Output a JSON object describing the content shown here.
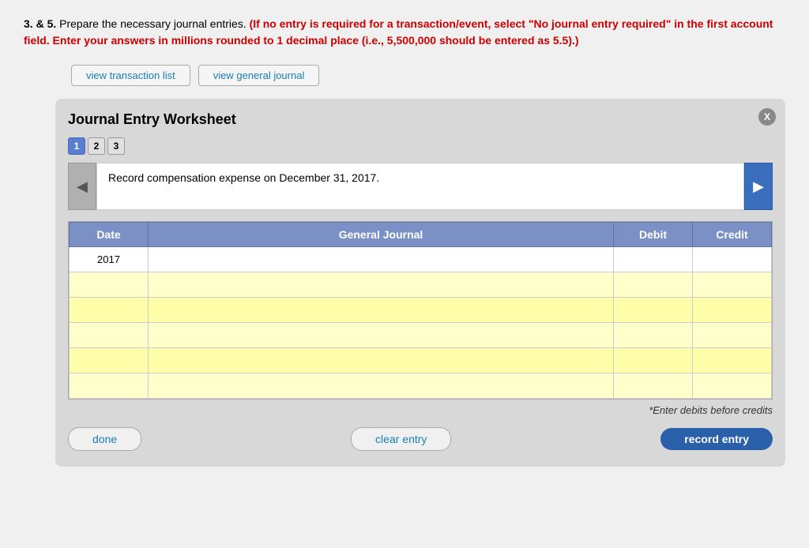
{
  "question": {
    "number": "3. & 5.",
    "main_text": "Prepare the necessary journal entries.",
    "instruction": "(If no entry is required for a transaction/event, select \"No journal entry required\" in the first account field. Enter your answers in millions rounded to 1 decimal place (i.e., 5,500,000 should be entered as 5.5).)"
  },
  "buttons": {
    "view_transaction_list": "view transaction list",
    "view_general_journal": "view general journal",
    "done": "done",
    "clear_entry": "clear entry",
    "record_entry": "record entry"
  },
  "worksheet": {
    "title": "Journal Entry Worksheet",
    "close_label": "X",
    "tabs": [
      {
        "label": "1",
        "active": true
      },
      {
        "label": "2",
        "active": false
      },
      {
        "label": "3",
        "active": false
      }
    ],
    "description": "Record compensation expense on December 31, 2017.",
    "table": {
      "headers": [
        "Date",
        "General Journal",
        "Debit",
        "Credit"
      ],
      "rows": [
        {
          "date": "2017",
          "journal": "",
          "debit": "",
          "credit": ""
        },
        {
          "date": "",
          "journal": "",
          "debit": "",
          "credit": ""
        },
        {
          "date": "",
          "journal": "",
          "debit": "",
          "credit": ""
        },
        {
          "date": "",
          "journal": "",
          "debit": "",
          "credit": ""
        },
        {
          "date": "",
          "journal": "",
          "debit": "",
          "credit": ""
        },
        {
          "date": "",
          "journal": "",
          "debit": "",
          "credit": ""
        }
      ]
    },
    "hint": "*Enter debits before credits"
  }
}
